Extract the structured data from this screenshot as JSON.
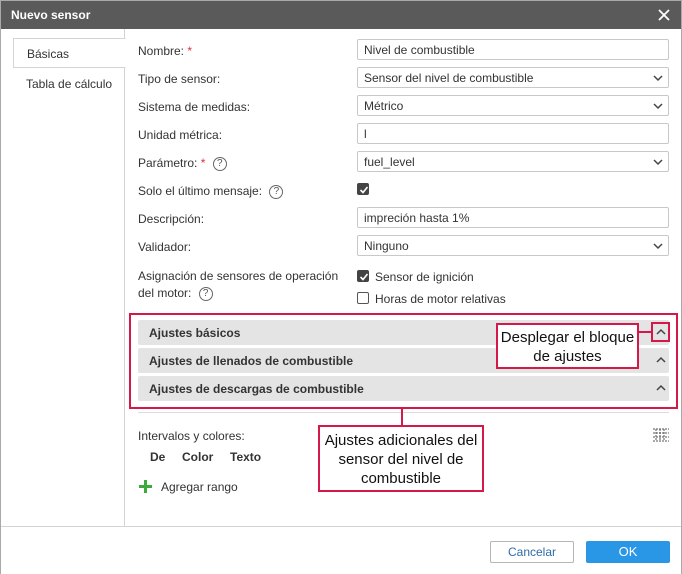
{
  "window": {
    "title": "Nuevo sensor"
  },
  "tabs": [
    {
      "label": "Básicas"
    },
    {
      "label": "Tabla de cálculo"
    }
  ],
  "form": {
    "name_label": "Nombre:",
    "name_value": "Nivel de combustible",
    "type_label": "Tipo de sensor:",
    "type_value": "Sensor del nivel de combustible",
    "measure_label": "Sistema de medidas:",
    "measure_value": "Métrico",
    "unit_label": "Unidad métrica:",
    "unit_value": "l",
    "param_label": "Parámetro:",
    "param_value": "fuel_level",
    "last_msg_label": "Solo el último mensaje:",
    "last_msg_checked": true,
    "desc_label": "Descripción:",
    "desc_value": "impreción hasta 1%",
    "validator_label": "Validador:",
    "validator_value": "Ninguno",
    "engine_label_line1": "Asignación de sensores de operación",
    "engine_label_line2": "del motor:",
    "ignition_label": "Sensor de ignición",
    "ignition_checked": true,
    "hours_label": "Horas de motor relativas",
    "hours_checked": false,
    "required_mark": "*",
    "help_mark": "?"
  },
  "accordions": [
    {
      "title": "Ajustes básicos"
    },
    {
      "title": "Ajustes de llenados de combustible"
    },
    {
      "title": "Ajustes de descargas de combustible"
    }
  ],
  "intervals": {
    "label": "Intervalos y colores:",
    "columns": [
      "De",
      "Color",
      "Texto"
    ],
    "add_range_label": "Agregar rango",
    "add_icon": "plus-icon",
    "table_icon": "table-toggle-icon"
  },
  "annotations": {
    "expand_note": "Desplegar el bloque de ajustes",
    "extra_note": "Ajustes adicionales del sensor del nivel de combustible"
  },
  "footer": {
    "cancel_label": "Cancelar",
    "ok_label": "OK"
  },
  "colors": {
    "titlebar": "#5a5a5a",
    "accent": "#2a96e6",
    "annotation": "#d4184a",
    "add_icon": "#3daa3d"
  }
}
